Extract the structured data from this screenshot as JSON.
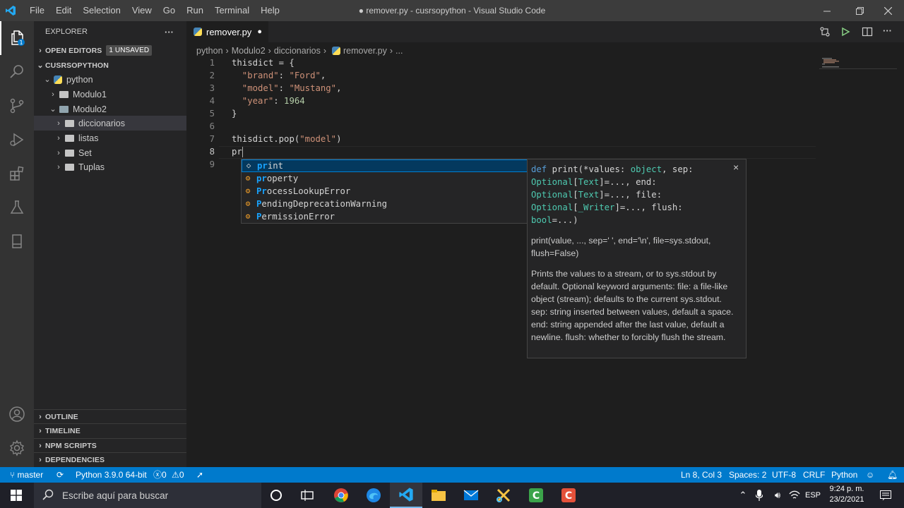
{
  "titlebar": {
    "menu": [
      "File",
      "Edit",
      "Selection",
      "View",
      "Go",
      "Run",
      "Terminal",
      "Help"
    ],
    "title": "● remover.py - cusrsopython - Visual Studio Code"
  },
  "sidebar": {
    "explorer_label": "EXPLORER",
    "more": "···",
    "open_editors": "OPEN EDITORS",
    "unsaved_badge": "1 UNSAVED",
    "workspace": "CUSRSOPYTHON",
    "tree": [
      {
        "label": "python",
        "depth": 1,
        "open": true
      },
      {
        "label": "Modulo1",
        "depth": 2,
        "open": false
      },
      {
        "label": "Modulo2",
        "depth": 2,
        "open": true
      },
      {
        "label": "diccionarios",
        "depth": 3,
        "open": false
      },
      {
        "label": "listas",
        "depth": 3,
        "open": false
      },
      {
        "label": "Set",
        "depth": 3,
        "open": false
      },
      {
        "label": "Tuplas",
        "depth": 3,
        "open": false
      }
    ],
    "outline": "OUTLINE",
    "timeline": "TIMELINE",
    "npm_scripts": "NPM SCRIPTS",
    "dependencies": "DEPENDENCIES"
  },
  "tab": {
    "label": "remover.py",
    "dirty": "●"
  },
  "breadcrumb": [
    "python",
    "›",
    "Modulo2",
    "›",
    "diccionarios",
    "›",
    "remover.py",
    "›",
    "..."
  ],
  "code": {
    "line_numbers": [
      "1",
      "2",
      "3",
      "4",
      "5",
      "6",
      "7",
      "8",
      "9"
    ],
    "l1": "thisdict = {",
    "l2k": "  \"brand\"",
    "l2c": ": ",
    "l2v": "\"Ford\"",
    "l2e": ",",
    "l3k": "  \"model\"",
    "l3c": ": ",
    "l3v": "\"Mustang\"",
    "l3e": ",",
    "l4k": "  \"year\"",
    "l4c": ": ",
    "l4v": "1964",
    "l5": "}",
    "l7a": "thisdict.",
    "l7f": "pop",
    "l7b": "(",
    "l7s": "\"model\"",
    "l7c": ")",
    "l8": "pr"
  },
  "suggestions": [
    {
      "match": "pr",
      "rest": "int",
      "icon": "module"
    },
    {
      "match": "pr",
      "rest": "operty",
      "icon": "class"
    },
    {
      "match": "Pr",
      "rest": "ocessLookupError",
      "icon": "class"
    },
    {
      "match": "P",
      "rest": "endingDeprecationWarning",
      "icon": "class"
    },
    {
      "match": "P",
      "rest": "ermissionError",
      "icon": "class"
    }
  ],
  "details": {
    "sig1a": "def",
    "sig1b": " print(*values: ",
    "sig1c": "object",
    "sig1d": ", sep:",
    "sig2a": "Optional",
    "sig2b": "[",
    "sig2c": "Text",
    "sig2d": "]=..., end:",
    "sig3a": "Optional",
    "sig3b": "[",
    "sig3c": "Text",
    "sig3d": "]=..., file:",
    "sig4a": "Optional",
    "sig4b": "[",
    "sig4c": "_Writer",
    "sig4d": "]=..., flush:",
    "sig5a": "bool",
    "sig5b": "=...)",
    "usage": "print(value, ..., sep=' ', end='\\n', file=sys.stdout, flush=False)",
    "doc": "Prints the values to a stream, or to sys.stdout by default. Optional keyword arguments: file: a file-like object (stream); defaults to the current sys.stdout. sep: string inserted between values, default a space. end: string appended after the last value, default a newline. flush: whether to forcibly flush the stream.",
    "close": "×"
  },
  "statusbar": {
    "branch": "master",
    "python": "Python 3.9.0 64-bit",
    "errors": "0",
    "warnings": "0",
    "position": "Ln 8, Col 3",
    "spaces": "Spaces: 2",
    "encoding": "UTF-8",
    "eol": "CRLF",
    "language": "Python"
  },
  "taskbar": {
    "search_placeholder": "Escribe aquí para buscar",
    "lang": "ESP",
    "time": "9:24 p. m.",
    "date": "23/2/2021"
  },
  "colors": {
    "accent": "#007acc",
    "activity": "#333333",
    "sidebar": "#252526",
    "editor": "#1e1e1e"
  }
}
